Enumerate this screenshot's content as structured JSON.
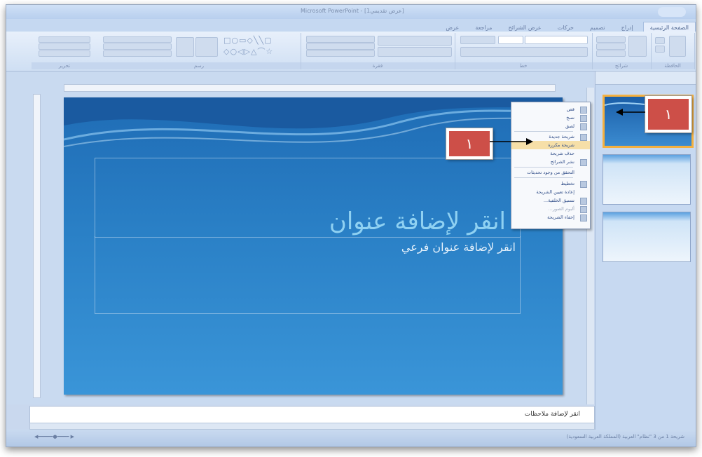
{
  "window": {
    "title": "Microsoft PowerPoint - [عرض تقديمي1]"
  },
  "ribbon": {
    "tabs": [
      "الصفحة الرئيسية",
      "إدراج",
      "تصميم",
      "حركات",
      "عرض الشرائح",
      "مراجعة",
      "عرض"
    ],
    "active_tab": "الصفحة الرئيسية",
    "groups": [
      "الحافظة",
      "شرائح",
      "خط",
      "فقرة",
      "رسم",
      "تحرير"
    ]
  },
  "slide": {
    "title_placeholder": "انقر لإضافة عنوان",
    "subtitle_placeholder": "انقر لإضافة عنوان فرعي"
  },
  "notes": {
    "placeholder": "انقر لإضافة ملاحظات"
  },
  "context_menu": {
    "items": [
      {
        "label": "قص",
        "highlighted": false,
        "disabled": false
      },
      {
        "label": "نسخ",
        "highlighted": false,
        "disabled": false
      },
      {
        "label": "لصق",
        "highlighted": false,
        "disabled": false
      },
      {
        "label": "شريحة جديدة",
        "highlighted": false,
        "disabled": false
      },
      {
        "label": "شريحة مكررة",
        "highlighted": true,
        "disabled": false
      },
      {
        "label": "حذف شريحة",
        "highlighted": false,
        "disabled": false
      },
      {
        "label": "نشر الشرائح",
        "highlighted": false,
        "disabled": false
      },
      {
        "label": "التحقق من وجود تحديثات",
        "highlighted": false,
        "disabled": false
      },
      {
        "label": "تخطيط",
        "highlighted": false,
        "disabled": false
      },
      {
        "label": "إعادة تعيين الشريحة",
        "highlighted": false,
        "disabled": false
      },
      {
        "label": "تنسيق الخلفية...",
        "highlighted": false,
        "disabled": false
      },
      {
        "label": "ألبوم الصور...",
        "highlighted": false,
        "disabled": true
      },
      {
        "label": "إخفاء الشريحة",
        "highlighted": false,
        "disabled": false
      }
    ]
  },
  "callouts": {
    "one": "١",
    "two": "١"
  },
  "status": {
    "text": "شريحة 1 من 3   \"نظام\"   العربية (المملكة العربية السعودية)"
  },
  "colors": {
    "slide_bg": "#2a80c6",
    "callout": "#cd4f48",
    "highlight": "#f6dfa8"
  }
}
